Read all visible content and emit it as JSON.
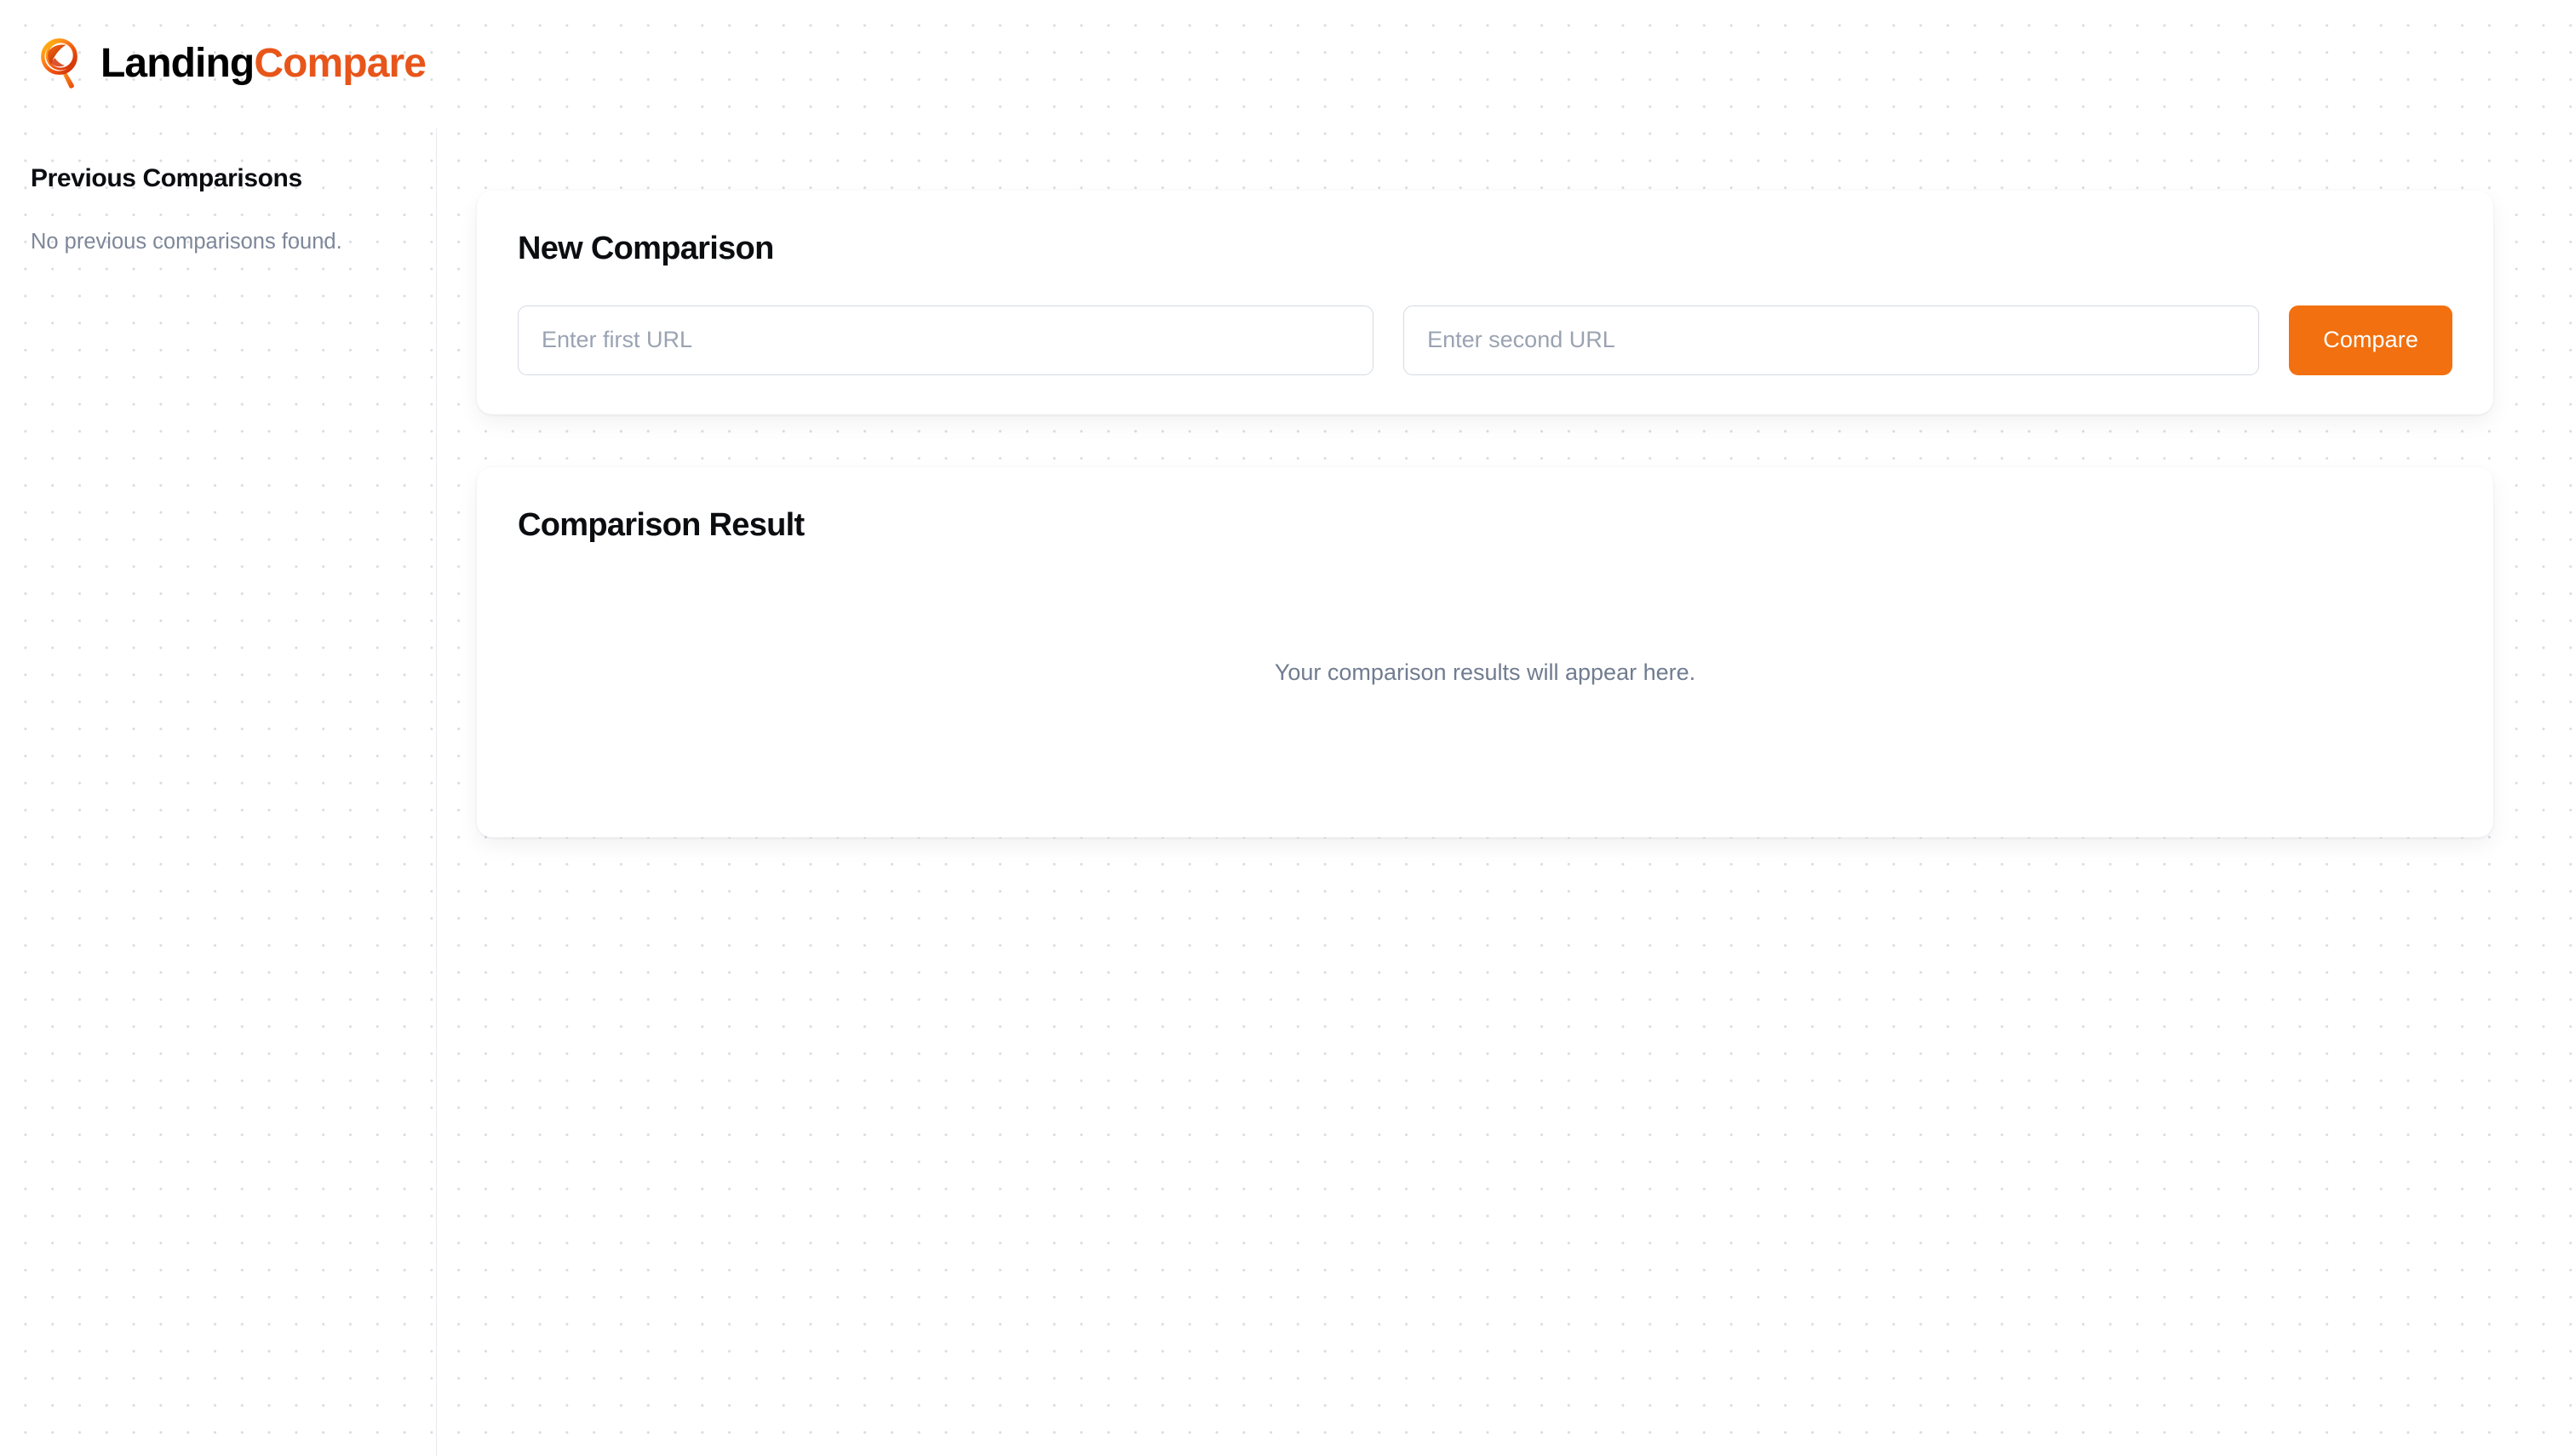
{
  "header": {
    "logo_icon": "magnifying-glass-icon",
    "brand_primary": "Landing",
    "brand_accent": "Compare"
  },
  "sidebar": {
    "title": "Previous Comparisons",
    "empty_message": "No previous comparisons found."
  },
  "main": {
    "new_comparison": {
      "title": "New Comparison",
      "first_url_value": "",
      "first_url_placeholder": "Enter first URL",
      "second_url_value": "",
      "second_url_placeholder": "Enter second URL",
      "compare_label": "Compare"
    },
    "result": {
      "title": "Comparison Result",
      "empty_message": "Your comparison results will appear here."
    }
  },
  "colors": {
    "accent_button": "#F2700F",
    "accent_brand_text": "#E8551A",
    "text_primary": "#0b0d11",
    "text_muted": "#7d8798",
    "input_border": "#d5d9e0",
    "dot_grid": "#dadde3"
  }
}
